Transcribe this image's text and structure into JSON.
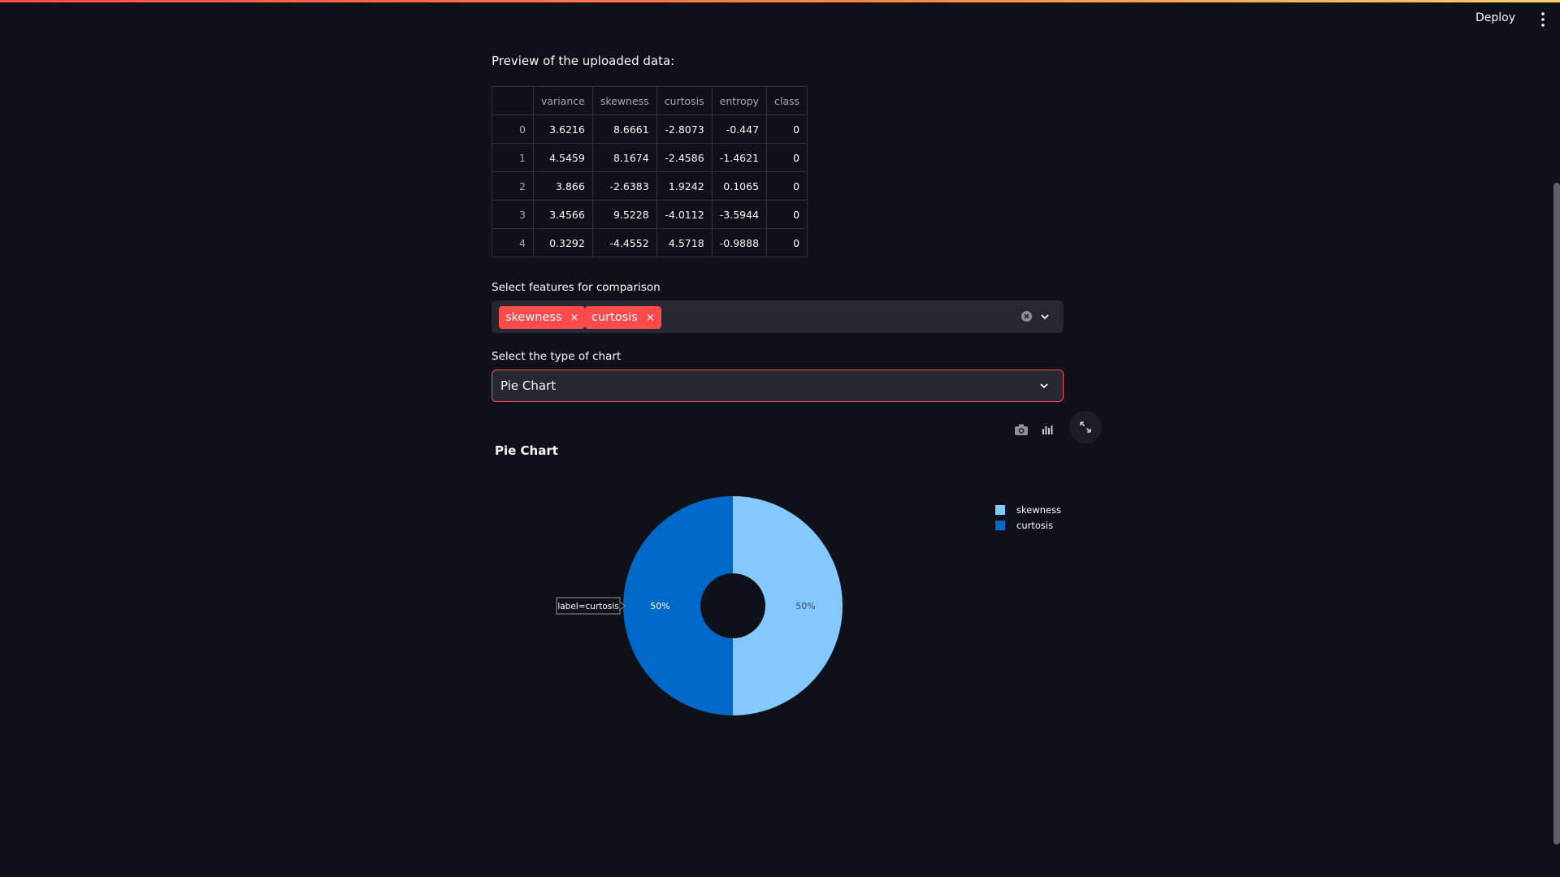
{
  "header": {
    "deploy_label": "Deploy"
  },
  "preview": {
    "caption": "Preview of the uploaded data:",
    "columns": [
      "",
      "variance",
      "skewness",
      "curtosis",
      "entropy",
      "class"
    ],
    "rows": [
      [
        "0",
        "3.6216",
        "8.6661",
        "-2.8073",
        "-0.447",
        "0"
      ],
      [
        "1",
        "4.5459",
        "8.1674",
        "-2.4586",
        "-1.4621",
        "0"
      ],
      [
        "2",
        "3.866",
        "-2.6383",
        "1.9242",
        "0.1065",
        "0"
      ],
      [
        "3",
        "3.4566",
        "9.5228",
        "-4.0112",
        "-3.5944",
        "0"
      ],
      [
        "4",
        "0.3292",
        "-4.4552",
        "4.5718",
        "-0.9888",
        "0"
      ]
    ]
  },
  "features": {
    "label": "Select features for comparison",
    "chips": [
      "skewness",
      "curtosis"
    ],
    "chip_close": "×"
  },
  "chart_type": {
    "label": "Select the type of chart",
    "selected": "Pie Chart"
  },
  "colors": {
    "accent": "#ff4b4b",
    "background": "#0e1117",
    "skewness": "#83c9ff",
    "curtosis": "#0068c9"
  },
  "chart_data": {
    "type": "pie",
    "title": "Pie Chart",
    "hole": true,
    "labels": [
      "skewness",
      "curtosis"
    ],
    "values": [
      50,
      50
    ],
    "display_labels": [
      "50%",
      "50%"
    ],
    "colors": [
      "#83c9ff",
      "#0068c9"
    ],
    "hover_label": "label=curtosis",
    "legend_position": "top-right"
  }
}
